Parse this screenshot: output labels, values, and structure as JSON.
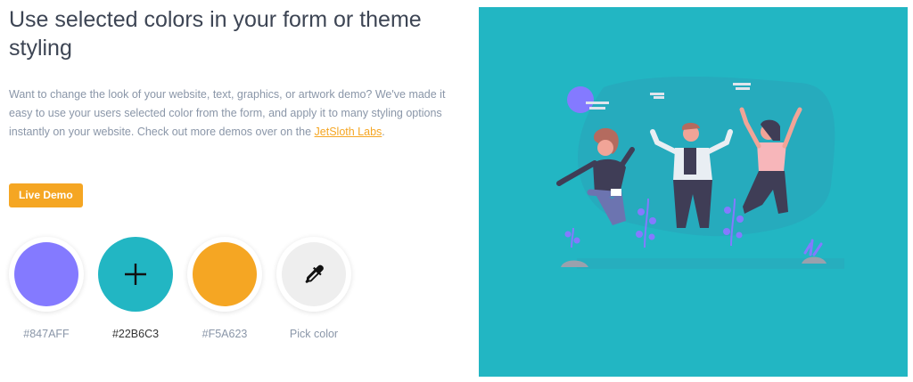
{
  "heading": "Use selected colors in your form or theme styling",
  "description": {
    "text_before": "Want to change the look of your website, text, graphics, or artwork demo? We've made it easy to use your users selected color from the form, and apply it to many styling options instantly on your website. Check out more demos over on the ",
    "link": "JetSloth Labs",
    "text_after": "."
  },
  "live_demo_label": "Live Demo",
  "swatches": [
    {
      "color": "#847AFF",
      "label": "#847AFF",
      "selected": false
    },
    {
      "color": "#22B6C3",
      "label": "#22B6C3",
      "selected": true,
      "icon": "plus-icon"
    },
    {
      "color": "#F5A623",
      "label": "#F5A623",
      "selected": false
    },
    {
      "color": "#EEEEEE",
      "label": "Pick color",
      "selected": false,
      "icon": "eyedropper-icon"
    }
  ],
  "illustration": {
    "background": "#22b6c3",
    "description_icon": "people-jumping-illustration"
  }
}
